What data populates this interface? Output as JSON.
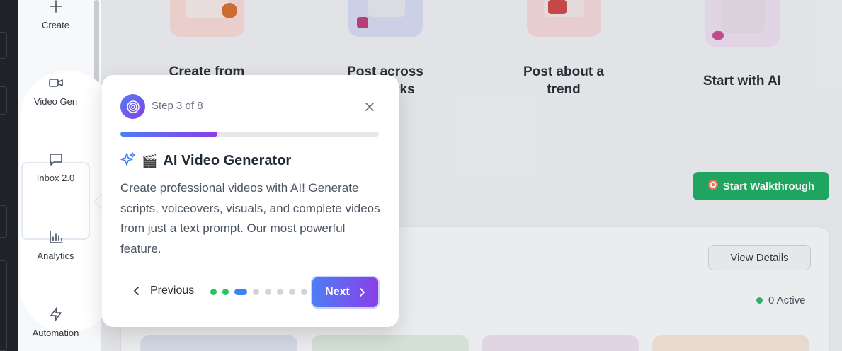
{
  "sidebar": {
    "items": [
      {
        "label": "Create",
        "icon": "plus-icon"
      },
      {
        "label": "Video Gen",
        "icon": "video-icon"
      },
      {
        "label": "Inbox 2.0",
        "icon": "message-icon"
      },
      {
        "label": "Analytics",
        "icon": "bar-chart-icon"
      },
      {
        "label": "Automation",
        "icon": "lightning-icon"
      }
    ]
  },
  "main": {
    "cards": [
      {
        "title": "Create from"
      },
      {
        "title": "Post across\nnetworks"
      },
      {
        "title": "Post about a\ntrend"
      },
      {
        "title": "Start with AI"
      }
    ],
    "start_walkthrough_label": "Start Walkthrough",
    "view_details_label": "View Details",
    "active_count_label": "0 Active"
  },
  "tour": {
    "step_text": "Step 3 of 8",
    "progress": 0.375,
    "title": "AI Video Generator",
    "description": "Create professional videos with AI! Generate scripts, voiceovers, visuals, and complete videos from just a text prompt. Our most powerful feature.",
    "previous_label": "Previous",
    "next_label": "Next",
    "total_steps": 8,
    "current_step": 3,
    "completed_steps": 2
  },
  "colors": {
    "accent_start": "#4f7df5",
    "accent_end": "#8b3ee8",
    "success": "#1fae63",
    "dot_done": "#22c55e",
    "dot_current": "#3b82f6",
    "dot_pending": "#d1d5db"
  }
}
